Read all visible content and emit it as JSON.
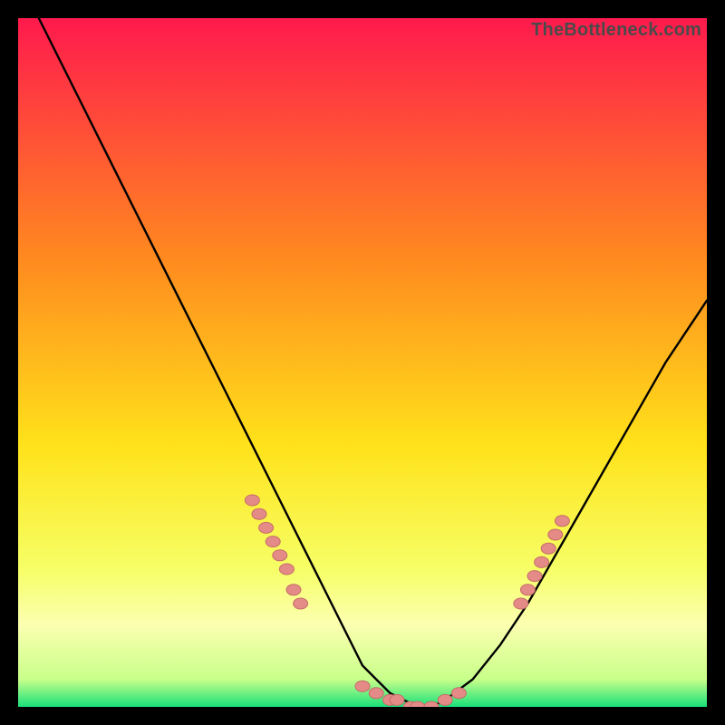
{
  "watermark": "TheBottleneck.com",
  "colors": {
    "bg_black": "#000000",
    "grad_top": "#ff1a4d",
    "grad_mid1": "#ff8a1f",
    "grad_mid2": "#ffe21a",
    "grad_low": "#f6ff66",
    "grad_band_pale": "#fcffb0",
    "grad_bottom": "#18e07a",
    "curve": "#000000",
    "dot_fill": "#e58b87",
    "dot_stroke": "#c46d68"
  },
  "chart_data": {
    "type": "line",
    "title": "",
    "xlabel": "",
    "ylabel": "",
    "xlim": [
      0,
      100
    ],
    "ylim": [
      0,
      100
    ],
    "series": [
      {
        "name": "curve",
        "x": [
          3,
          6,
          10,
          14,
          18,
          22,
          26,
          30,
          34,
          38,
          42,
          46,
          48,
          50,
          52,
          54,
          56,
          58,
          60,
          62,
          66,
          70,
          74,
          78,
          82,
          86,
          90,
          94,
          98,
          100
        ],
        "y": [
          100,
          94,
          86,
          78,
          70,
          62,
          54,
          46,
          38,
          30,
          22,
          14,
          10,
          6,
          4,
          2,
          1,
          0,
          0,
          1,
          4,
          9,
          15,
          22,
          29,
          36,
          43,
          50,
          56,
          59
        ]
      }
    ],
    "points": [
      {
        "name": "left_cluster",
        "x": [
          34,
          35,
          36,
          37,
          38,
          39,
          40,
          41
        ],
        "y": [
          30,
          28,
          26,
          24,
          22,
          20,
          17,
          15
        ]
      },
      {
        "name": "bottom_cluster",
        "x": [
          50,
          52,
          54,
          55,
          57,
          58,
          60,
          62,
          64
        ],
        "y": [
          3,
          2,
          1,
          1,
          0,
          0,
          0,
          1,
          2
        ]
      },
      {
        "name": "right_cluster",
        "x": [
          73,
          74,
          75,
          76,
          77,
          78,
          79
        ],
        "y": [
          15,
          17,
          19,
          21,
          23,
          25,
          27
        ]
      }
    ],
    "gradient_stops": [
      {
        "pct": 0,
        "color": "#ff1a4d"
      },
      {
        "pct": 35,
        "color": "#ff8a1f"
      },
      {
        "pct": 62,
        "color": "#ffe21a"
      },
      {
        "pct": 80,
        "color": "#f6ff66"
      },
      {
        "pct": 88,
        "color": "#fcffb0"
      },
      {
        "pct": 96,
        "color": "#c8ff8a"
      },
      {
        "pct": 100,
        "color": "#18e07a"
      }
    ]
  }
}
